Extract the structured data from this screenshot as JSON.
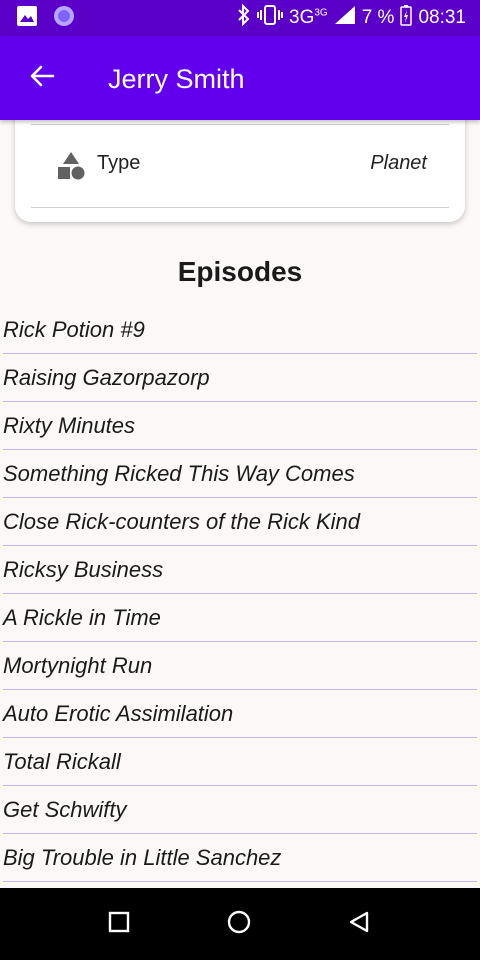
{
  "status_bar": {
    "network": "3G",
    "network_sup": "3G",
    "battery": "7 %",
    "time": "08:31"
  },
  "app_bar": {
    "title": "Jerry Smith"
  },
  "details": {
    "type_label": "Type",
    "type_value": "Planet"
  },
  "episodes": {
    "title": "Episodes",
    "items": [
      "Rick Potion #9",
      "Raising Gazorpazorp",
      "Rixty Minutes",
      "Something Ricked This Way Comes",
      "Close Rick-counters of the Rick Kind",
      "Ricksy Business",
      "A Rickle in Time",
      "Mortynight Run",
      "Auto Erotic Assimilation",
      "Total Rickall",
      "Get Schwifty",
      "Big Trouble in Little Sanchez"
    ]
  },
  "icons": {
    "status_left": [
      "image-icon",
      "circle-app-icon"
    ],
    "status_right": [
      "bluetooth-icon",
      "vibrate-icon",
      "signal-icon",
      "battery-charging-icon"
    ],
    "back": "back-arrow-icon",
    "type": "shapes-icon",
    "nav": [
      "recents-square-icon",
      "home-circle-icon",
      "back-triangle-icon"
    ]
  },
  "colors": {
    "status_bar": "#5b00c9",
    "app_bar": "#6200ee",
    "divider": "#c7b4ea"
  }
}
